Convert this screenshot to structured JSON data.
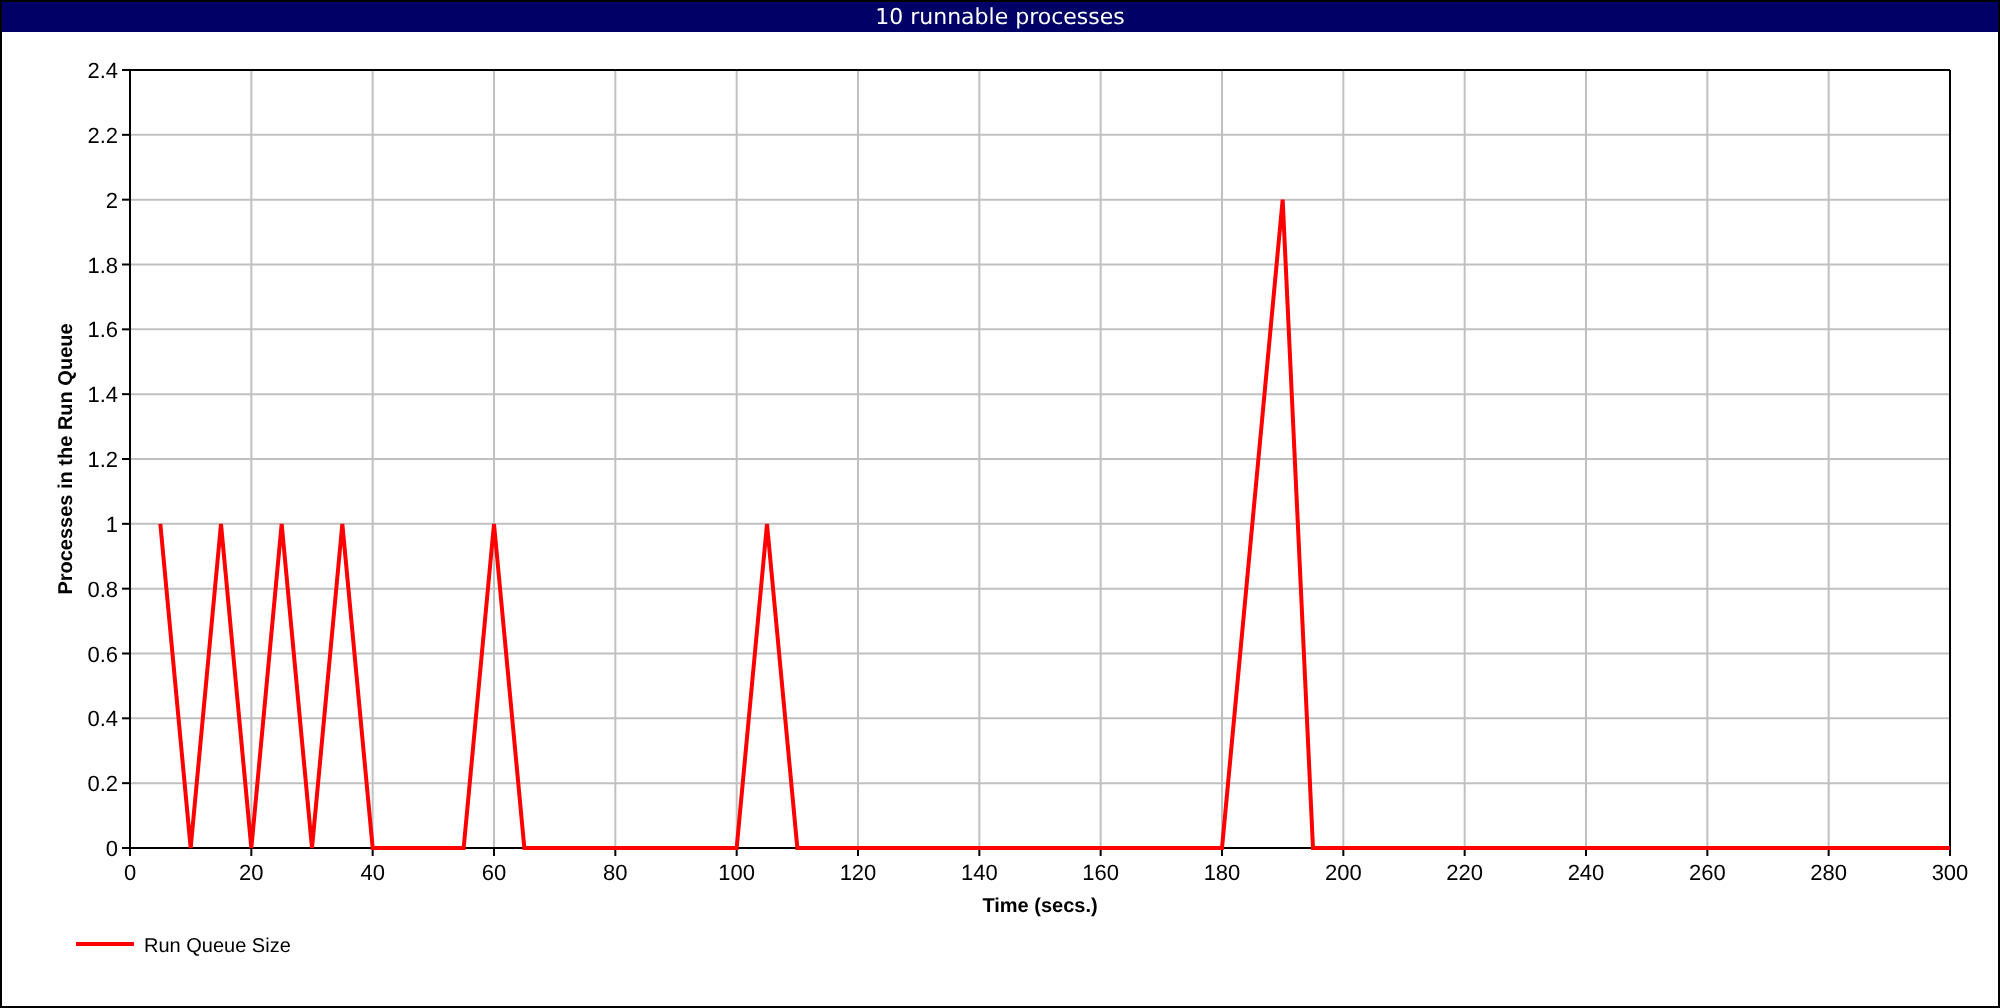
{
  "window": {
    "title": "10 runnable processes"
  },
  "chart_data": {
    "type": "line",
    "xlabel": "Time (secs.)",
    "ylabel": "Processes in the Run Queue",
    "x": [
      5,
      10,
      15,
      20,
      25,
      30,
      35,
      40,
      55,
      60,
      65,
      100,
      105,
      110,
      180,
      190,
      195,
      300
    ],
    "series": [
      {
        "name": "Run Queue Size",
        "color": "#ff0000",
        "values": [
          1,
          0,
          1,
          0,
          1,
          0,
          1,
          0,
          0,
          1,
          0,
          0,
          1,
          0,
          0,
          2,
          0,
          0
        ]
      }
    ],
    "grid": true,
    "xlim": [
      0,
      300
    ],
    "ylim": [
      0,
      2.4
    ],
    "xticks": [
      0,
      20,
      40,
      60,
      80,
      100,
      120,
      140,
      160,
      180,
      200,
      220,
      240,
      260,
      280,
      300
    ],
    "yticks": [
      0,
      {
        "value": 0.2,
        "label": "0.2"
      },
      {
        "value": 0.4,
        "label": "0.4"
      },
      {
        "value": 0.6,
        "label": "0.6"
      },
      {
        "value": 0.8,
        "label": "0.8"
      },
      1,
      {
        "value": 1.2,
        "label": "1.2"
      },
      {
        "value": 1.4,
        "label": "1.4"
      },
      {
        "value": 1.6,
        "label": "1.6"
      },
      {
        "value": 1.8,
        "label": "1.8"
      },
      2,
      {
        "value": 2.2,
        "label": "2.2"
      },
      {
        "value": 2.4,
        "label": "2.4"
      }
    ]
  }
}
